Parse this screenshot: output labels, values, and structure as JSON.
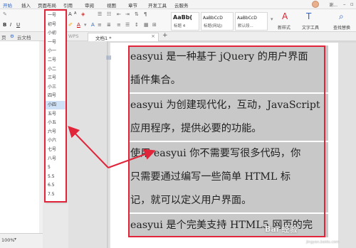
{
  "ribbon_tabs": [
    "开始",
    "插入",
    "页面布局",
    "引用",
    "审阅",
    "视图",
    "章节",
    "开发工具",
    "云服务"
  ],
  "user": {
    "name": "谢..."
  },
  "ribbon": {
    "bold": "B",
    "italic": "I",
    "underline": "U",
    "styles": [
      {
        "sample": "AaBb(",
        "caption": "标题 4"
      },
      {
        "sample": "AaBbCcD",
        "caption": "标题(网站)"
      },
      {
        "sample": "AaBbCcD",
        "caption": "默认段..."
      }
    ],
    "new_style_caption": "新样式",
    "text_tool_caption": "文字工具",
    "find_replace_caption": "查找替换"
  },
  "docbar": {
    "left_label": "页",
    "cloud_label": "云文档",
    "wps_label": "WPS",
    "doc_tab_label": "文档1 *",
    "add_label": "+"
  },
  "font_sizes": [
    "一号",
    "初号",
    "小初",
    "一号",
    "小一",
    "二号",
    "小二",
    "三号",
    "小三",
    "四号",
    "小四",
    "五号",
    "小五",
    "六号",
    "小六",
    "七号",
    "八号",
    "5",
    "5.5",
    "6.5",
    "7.5"
  ],
  "selected_font_size": "小四",
  "paragraphs": [
    {
      "lines": [
        "easyui 是一种基于 jQuery 的用户界面",
        "插件集合。"
      ]
    },
    {
      "lines": [
        "easyui 为创建现代化，互动，JavaScript",
        "应用程序，提供必要的功能。"
      ]
    },
    {
      "lines": [
        "使用 easyui 你不需要写很多代码，你",
        "只需要通过编写一些简单 HTML 标",
        "记，就可以定义用户界面。"
      ]
    },
    {
      "lines": [
        "easyui 是个完美支持 HTML5 网页的完"
      ]
    }
  ],
  "status": {
    "zoom": "100%"
  },
  "watermark": {
    "brand": "Bai 经验",
    "url": "jingyan.baidu.com"
  }
}
